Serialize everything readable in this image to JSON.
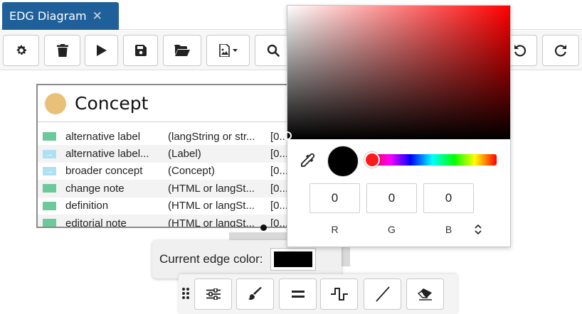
{
  "tabs": [
    {
      "label": "EDG Diagram",
      "close_glyph": "✕"
    }
  ],
  "toolbar": {
    "buttons": [
      {
        "name": "settings",
        "icon": "gear-icon"
      },
      {
        "name": "delete",
        "icon": "trash-icon"
      },
      {
        "name": "run",
        "icon": "play-icon"
      },
      {
        "name": "save",
        "icon": "floppy-icon"
      },
      {
        "name": "open",
        "icon": "folder-open-icon"
      },
      {
        "name": "export-image",
        "icon": "image-dropdown-icon"
      },
      {
        "name": "search",
        "icon": "search-icon"
      },
      {
        "name": "undo",
        "icon": "undo-icon"
      },
      {
        "name": "redo",
        "icon": "redo-icon"
      }
    ]
  },
  "node": {
    "title": "Concept",
    "circle_color": "#e8c077",
    "rows": [
      {
        "icon": "green-square-icon",
        "name": "alternative label",
        "type": "(langString or str...",
        "card": "[0..."
      },
      {
        "icon": "arrow-right-icon",
        "name": "alternative label...",
        "type": "(Label)",
        "card": "[0..."
      },
      {
        "icon": "arrow-right-icon",
        "name": "broader concept",
        "type": "(Concept)",
        "card": "[0..."
      },
      {
        "icon": "green-square-icon",
        "name": "change note",
        "type": "(HTML or langSt...",
        "card": "[0..."
      },
      {
        "icon": "green-square-icon",
        "name": "definition",
        "type": "(HTML or langSt...",
        "card": "[0..."
      },
      {
        "icon": "green-square-icon",
        "name": "editorial note",
        "type": "(HTML or langSt...",
        "card": "[0..."
      }
    ]
  },
  "edge_color": {
    "label": "Current edge color:",
    "value": "#000000"
  },
  "bottom_toolbar": {
    "buttons": [
      {
        "name": "properties",
        "icon": "sliders-icon"
      },
      {
        "name": "paint",
        "icon": "brush-icon"
      },
      {
        "name": "line-weight",
        "icon": "equals-icon"
      },
      {
        "name": "orthogonal-edge",
        "icon": "step-line-icon"
      },
      {
        "name": "straight-edge",
        "icon": "diagonal-line-icon"
      },
      {
        "name": "erase",
        "icon": "eraser-icon"
      }
    ]
  },
  "color_picker": {
    "hue_color": "#ff0000",
    "preview_color": "#000000",
    "r": "0",
    "g": "0",
    "b": "0",
    "labels": {
      "r": "R",
      "g": "G",
      "b": "B"
    }
  }
}
